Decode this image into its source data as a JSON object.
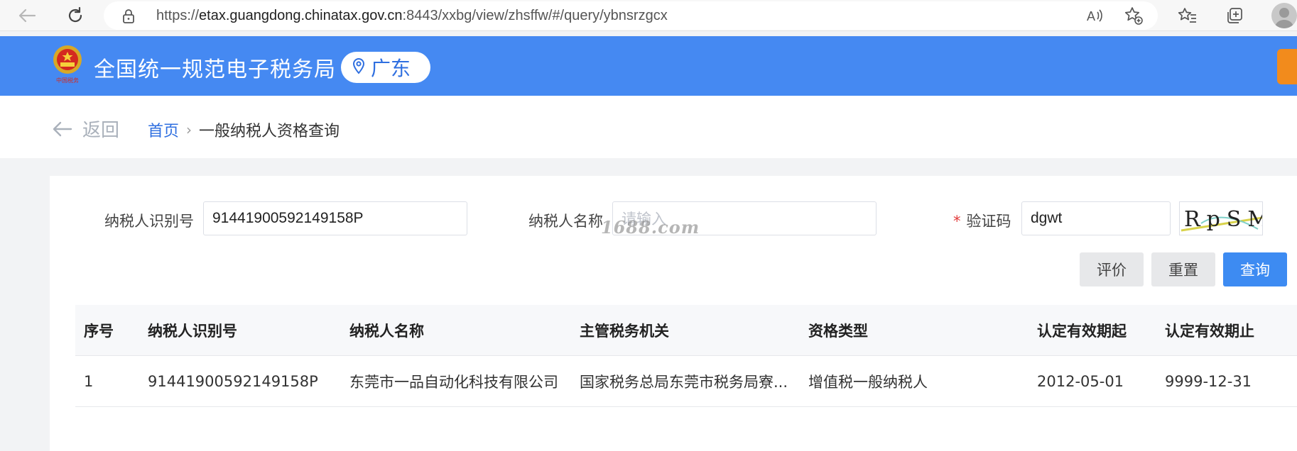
{
  "browser": {
    "url_prefix": "https://",
    "url_host": "etax.guangdong.chinatax.gov.cn",
    "url_rest": ":8443/xxbg/view/zhsffw/#/query/ybnsrzgcx",
    "icons": [
      "back-icon",
      "refresh-icon",
      "lock-icon",
      "read-aloud-icon",
      "add-favorite-icon",
      "favorites-icon",
      "collections-icon",
      "profile-avatar"
    ]
  },
  "header": {
    "title": "全国统一规范电子税务局",
    "region": "广东",
    "emblem_caption": "中国税务"
  },
  "breadcrumb": {
    "back_label": "返回",
    "home": "首页",
    "separator": "›",
    "current": "一般纳税人资格查询"
  },
  "form": {
    "taxpayer_id_label": "纳税人识别号",
    "taxpayer_id_value": "91441900592149158P",
    "taxpayer_name_label": "纳税人名称",
    "taxpayer_name_placeholder": "请输入",
    "captcha_required_mark": "*",
    "captcha_label": "验证码",
    "captcha_value": "dgwt",
    "captcha_text": "RpSM"
  },
  "buttons": {
    "evaluate": "评价",
    "reset": "重置",
    "query": "查询"
  },
  "watermark": "1688.com",
  "table": {
    "columns": [
      "序号",
      "纳税人识别号",
      "纳税人名称",
      "主管税务机关",
      "资格类型",
      "认定有效期起",
      "认定有效期止"
    ],
    "rows": [
      [
        "1",
        "91441900592149158P",
        "东莞市一品自动化科技有限公司",
        "国家税务总局东莞市税务局寮...",
        "增值税一般纳税人",
        "2012-05-01",
        "9999-12-31"
      ]
    ]
  },
  "colors": {
    "header_blue": "#4589f2",
    "link_blue": "#2f6fe0",
    "primary_button": "#3d8bf2",
    "required_red": "#e23c3c",
    "accent_orange": "#f28b1c"
  }
}
